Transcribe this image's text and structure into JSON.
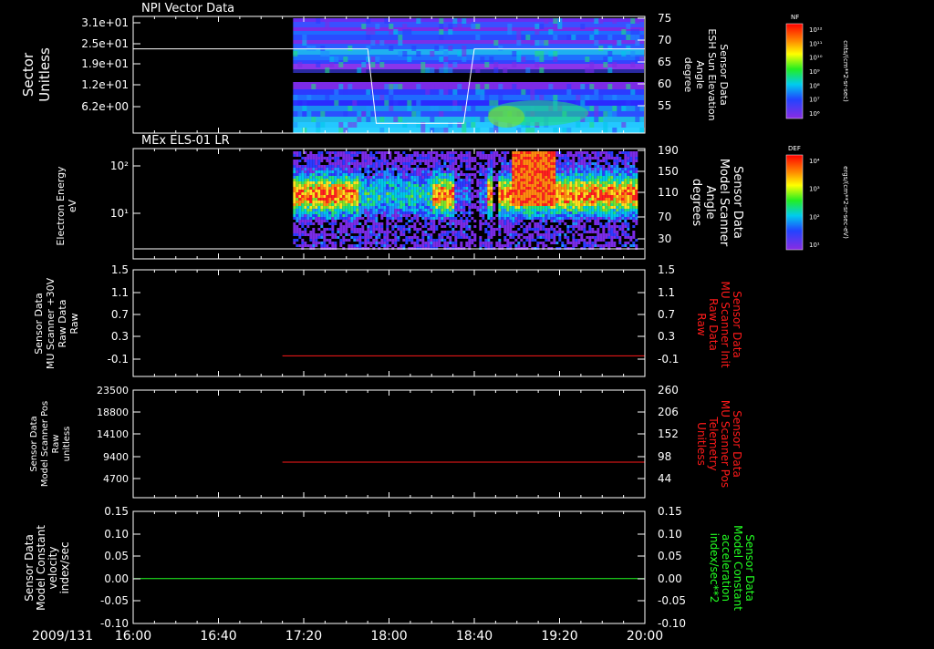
{
  "colors": {
    "bg": "#000000",
    "fg": "#ffffff",
    "red": "#ff1a1a",
    "green": "#22ff22"
  },
  "chart_data": [
    {
      "type": "heatmap",
      "title": "NPI Vector Data",
      "ylabel_left": [
        "Sector",
        "Unitless"
      ],
      "yticks_left": [
        "3.1e+01",
        "2.5e+01",
        "1.9e+01",
        "1.2e+01",
        "6.2e+00"
      ],
      "ylabel_right": [
        "Sensor Data",
        "ESH Sun Elevation",
        "Angle",
        "degree"
      ],
      "yticks_right": [
        "75",
        "70",
        "65",
        "60",
        "55"
      ],
      "colorbar": {
        "label": "NF",
        "unit": "cnts/(cm**2-sr-sec)",
        "ticks": [
          "10¹²",
          "10¹¹",
          "10¹⁰",
          "10⁹",
          "10⁸",
          "10⁷",
          "10⁶"
        ]
      },
      "overlay_line": {
        "name": "ESH Sun Elevation Angle",
        "points": [
          [
            "16:00",
            68
          ],
          [
            "17:15",
            68
          ],
          [
            "17:50",
            68
          ],
          [
            "17:54",
            51
          ],
          [
            "18:35",
            51
          ],
          [
            "18:40",
            68
          ],
          [
            "20:00",
            68
          ]
        ]
      }
    },
    {
      "type": "heatmap",
      "title": "MEx ELS-01 LR",
      "ylabel_left": [
        "Electron Energy",
        "eV"
      ],
      "yticks_left": [
        "10²",
        "10¹"
      ],
      "ylabel_right": [
        "Sensor Data",
        "Model Scanner",
        "Angle",
        "degrees"
      ],
      "yticks_right": [
        "190",
        "150",
        "110",
        "70",
        "30"
      ],
      "colorbar": {
        "label": "DEF",
        "unit": "ergs/(cm**2-sr-sec-eV)",
        "ticks": [
          "10⁴",
          "10³",
          "10²",
          "10¹"
        ]
      },
      "overlay_line": {
        "name": "Model Scanner Angle",
        "value": 8
      }
    },
    {
      "type": "line",
      "ylabel_left": [
        "Sensor Data",
        "MU Scanner +30V",
        "Raw Data",
        "Raw"
      ],
      "yticks_left": [
        "1.5",
        "1.1",
        "0.7",
        "0.3",
        "-0.1"
      ],
      "ylabel_right": [
        "Sensor Data",
        "MU Scanner Init",
        "Raw Data",
        "Raw"
      ],
      "yticks_right": [
        "1.5",
        "1.1",
        "0.7",
        "0.3",
        "-0.1"
      ],
      "ylim": [
        -0.5,
        1.5
      ],
      "series": [
        {
          "color": "red",
          "x": [
            "17:10",
            "20:00"
          ],
          "y": [
            -0.04,
            -0.04
          ]
        }
      ]
    },
    {
      "type": "line",
      "ylabel_left": [
        "Sensor Data",
        "Model Scanner Pos",
        "Raw",
        "unitless"
      ],
      "yticks_left": [
        "23500",
        "18800",
        "14100",
        "9400",
        "4700"
      ],
      "ylabel_right": [
        "Sensor Data",
        "MU Scanner Pos",
        "Telemetry",
        "Unitless"
      ],
      "yticks_right": [
        "260",
        "206",
        "152",
        "98",
        "44"
      ],
      "ylim_right": [
        -10,
        260
      ],
      "series": [
        {
          "color": "red",
          "x": [
            "17:10",
            "20:00"
          ],
          "y": [
            84,
            84
          ]
        }
      ]
    },
    {
      "type": "line",
      "ylabel_left": [
        "Sensor Data",
        "Model Constant",
        "velocity",
        "index/sec"
      ],
      "yticks_left": [
        "0.15",
        "0.10",
        "0.05",
        "0.00",
        "-0.05",
        "-0.10"
      ],
      "ylabel_right": [
        "Sensor Data",
        "Model Constant",
        "acceleration",
        "index/sec**2"
      ],
      "yticks_right": [
        "0.15",
        "0.10",
        "0.05",
        "0.00",
        "-0.05",
        "-0.10"
      ],
      "ylim": [
        -0.1,
        0.15
      ],
      "series": [
        {
          "color": "green",
          "x": [
            "16:00",
            "20:00"
          ],
          "y": [
            0.0,
            0.0
          ]
        }
      ]
    }
  ],
  "xaxis": {
    "date": "2009/131",
    "ticks": [
      "16:00",
      "16:40",
      "17:20",
      "18:00",
      "18:40",
      "19:20",
      "20:00"
    ]
  }
}
